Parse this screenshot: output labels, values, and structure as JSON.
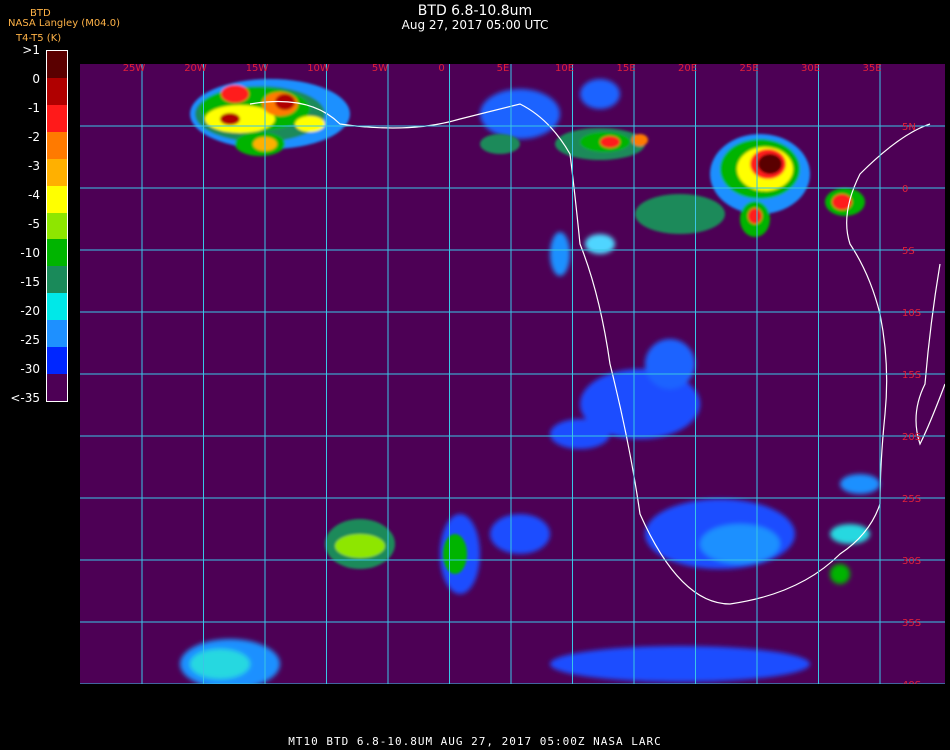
{
  "header": {
    "title": "BTD 6.8-10.8um",
    "subtitle": "Aug 27, 2017 05:00 UTC",
    "credit_line1": "NASA Langley (M04.0)",
    "credit_line2": "T4-T5 (K)",
    "credit_overlay": "BTD"
  },
  "legend": {
    "labels": [
      ">1",
      "0",
      "-1",
      "-2",
      "-3",
      "-4",
      "-5",
      "-10",
      "-15",
      "-20",
      "-25",
      "-30",
      "<-35"
    ],
    "colors": [
      "#5a0000",
      "#b00000",
      "#ff1a1a",
      "#ff7a00",
      "#ffb000",
      "#ffff00",
      "#8ee600",
      "#00b400",
      "#1a8a5a",
      "#00e8e8",
      "#1e90ff",
      "#0026ff",
      "#4d0055"
    ]
  },
  "map": {
    "background": "#4d0055",
    "grid_color": "#39c6e6",
    "lon_labels": [
      "25W",
      "20W",
      "15W",
      "10W",
      "5W",
      "0",
      "5E",
      "10E",
      "15E",
      "20E",
      "25E",
      "30E",
      "35E"
    ],
    "lat_labels": [
      "5N",
      "0",
      "5S",
      "10S",
      "15S",
      "20S",
      "25S",
      "30S",
      "35S",
      "40S"
    ],
    "label_color": "#e0203a"
  },
  "footer": {
    "text": "MT10   BTD 6.8-10.8UM    AUG 27, 2017 05:00Z   NASA LARC"
  }
}
